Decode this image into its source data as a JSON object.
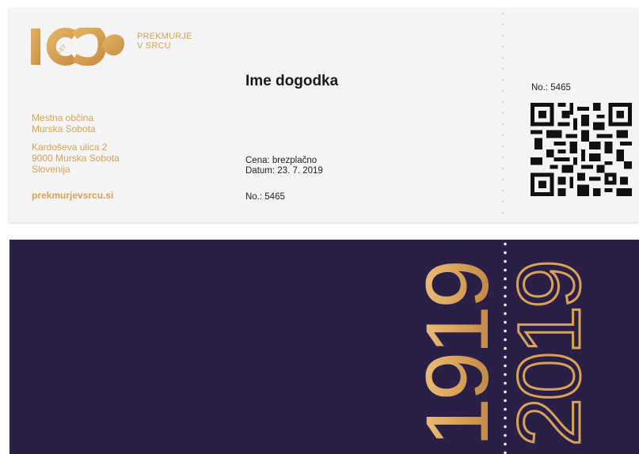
{
  "front": {
    "logo": {
      "number_text": "100",
      "small_text": "LET",
      "tagline_line1": "PREKMURJE",
      "tagline_line2": "V SRCU"
    },
    "event_title": "Ime dogodka",
    "organizer": {
      "name_line1": "Mestna občina",
      "name_line2": "Murska Sobota",
      "address_line1": "Kardoševa ulica 2",
      "address_line2": "9000 Murska Sobota",
      "address_line3": "Slovenija",
      "website": "prekmurjevsrcu.si"
    },
    "price": "Cena: brezplačno",
    "date": "Datum: 23. 7. 2019",
    "number": "No.: 5465",
    "stub_number": "No.: 5465"
  },
  "back": {
    "year_left": "1919",
    "year_right": "2019"
  },
  "colors": {
    "gold": "#d5a256",
    "navy": "#2a1f47",
    "paper": "#f4f4f4"
  },
  "icons": {
    "qr_code": "qr-code-icon",
    "logo": "logo-100-icon"
  }
}
